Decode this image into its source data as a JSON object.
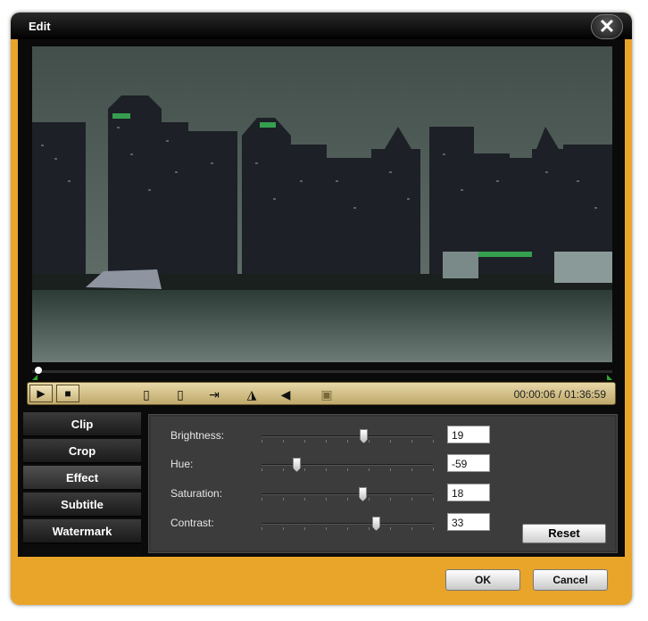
{
  "window": {
    "title": "Edit",
    "close_label": "✕"
  },
  "player": {
    "timecode": "00:00:06 / 01:36:59",
    "progress_fraction": 0.001,
    "controls": [
      {
        "name": "play-button",
        "glyph": "▶"
      },
      {
        "name": "stop-button",
        "glyph": "■"
      }
    ],
    "tools": [
      {
        "name": "snapshot-frame-icon",
        "glyph": "▯"
      },
      {
        "name": "film-frame-icon",
        "glyph": "▯"
      },
      {
        "name": "go-to-icon",
        "glyph": "⇥"
      },
      {
        "name": "flip-horizontal-icon",
        "glyph": "◮"
      },
      {
        "name": "flip-vertical-icon",
        "glyph": "◀"
      },
      {
        "name": "image-icon",
        "glyph": "▣"
      }
    ]
  },
  "tabs": [
    "Clip",
    "Crop",
    "Effect",
    "Subtitle",
    "Watermark"
  ],
  "active_tab": "Effect",
  "effect": {
    "rows": [
      {
        "label": "Brightness:",
        "value": "19",
        "fraction": 0.595
      },
      {
        "label": "Hue:",
        "value": "-59",
        "fraction": 0.205
      },
      {
        "label": "Saturation:",
        "value": "18",
        "fraction": 0.59
      },
      {
        "label": "Contrast:",
        "value": "33",
        "fraction": 0.665
      }
    ],
    "reset_label": "Reset"
  },
  "footer": {
    "ok_label": "OK",
    "cancel_label": "Cancel"
  }
}
